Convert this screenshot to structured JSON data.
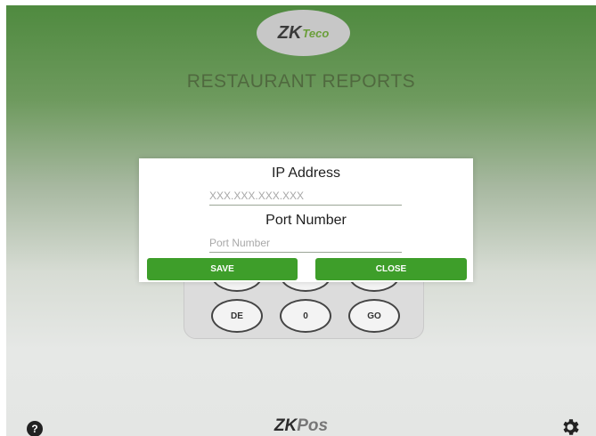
{
  "header": {
    "logo_main": "ZK",
    "logo_accent": "Teco",
    "title": "RESTAURANT REPORTS"
  },
  "keypad": {
    "row_partial": [
      "",
      "",
      ""
    ],
    "row_last": [
      "DE",
      "0",
      "GO"
    ]
  },
  "dialog": {
    "ip_label": "IP Address",
    "ip_placeholder": "XXX.XXX.XXX.XXX",
    "port_label": "Port Number",
    "port_placeholder": "Port Number",
    "save_label": "SAVE",
    "close_label": "CLOSE"
  },
  "footer": {
    "help_glyph": "?",
    "brand_main": "ZK",
    "brand_accent": "Pos"
  },
  "colors": {
    "accent": "#3e9e2a",
    "header_green": "#4f8a3f",
    "title_text": "#50693f"
  },
  "icons": [
    "help-icon",
    "gear-icon"
  ]
}
